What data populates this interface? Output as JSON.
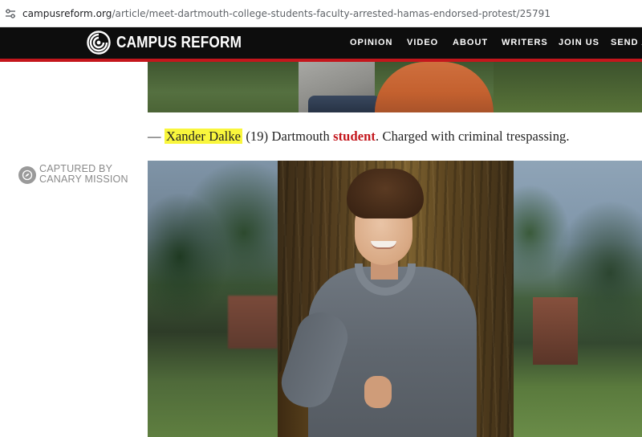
{
  "browser": {
    "url_host": "campusreform.org",
    "url_path": "/article/meet-dartmouth-college-students-faculty-arrested-hamas-endorsed-protest/25791"
  },
  "site": {
    "logo_text": "CAMPUS REFORM",
    "nav": [
      "OPINION",
      "VIDEO",
      "ABOUT",
      "WRITERS",
      "JOIN US",
      "SEND A"
    ],
    "colors": {
      "header_bg": "#0d0d0d",
      "accent_red": "#c4161c",
      "highlight": "#f9f63c"
    }
  },
  "article": {
    "caption": {
      "prefix": "— ",
      "name": "Xander Dalke",
      "middle": " (19) Dartmouth ",
      "role": "student",
      "suffix": ". Charged with criminal trespassing."
    },
    "badge": {
      "line1": "CAPTURED BY",
      "line2": "CANARY MISSION",
      "icon": "canary-mission-icon"
    }
  }
}
